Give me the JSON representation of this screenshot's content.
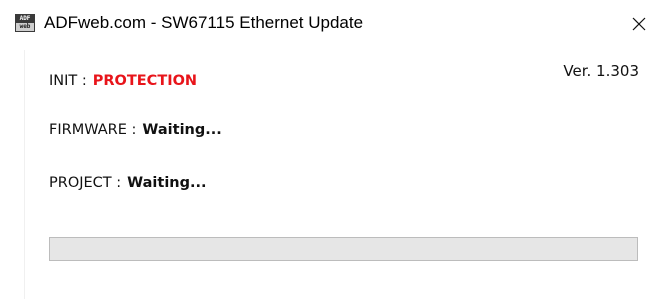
{
  "window": {
    "title": "ADFweb.com - SW67115 Ethernet Update",
    "icon_text_top": "ADF",
    "icon_text_bottom": "web",
    "close_glyph": "✕"
  },
  "version": "Ver. 1.303",
  "rows": {
    "init": {
      "label": "INIT :",
      "value": "PROTECTION"
    },
    "firmware": {
      "label": "FIRMWARE :",
      "value": "Waiting..."
    },
    "project": {
      "label": "PROJECT :",
      "value": "Waiting..."
    }
  },
  "progress": {
    "value_percent": 0
  },
  "colors": {
    "protection": "#e8141a",
    "progress_track": "#e6e6e6",
    "progress_fill": "#06b025"
  },
  "icons": {
    "app": "adfweb-app-icon",
    "close": "close-icon"
  }
}
